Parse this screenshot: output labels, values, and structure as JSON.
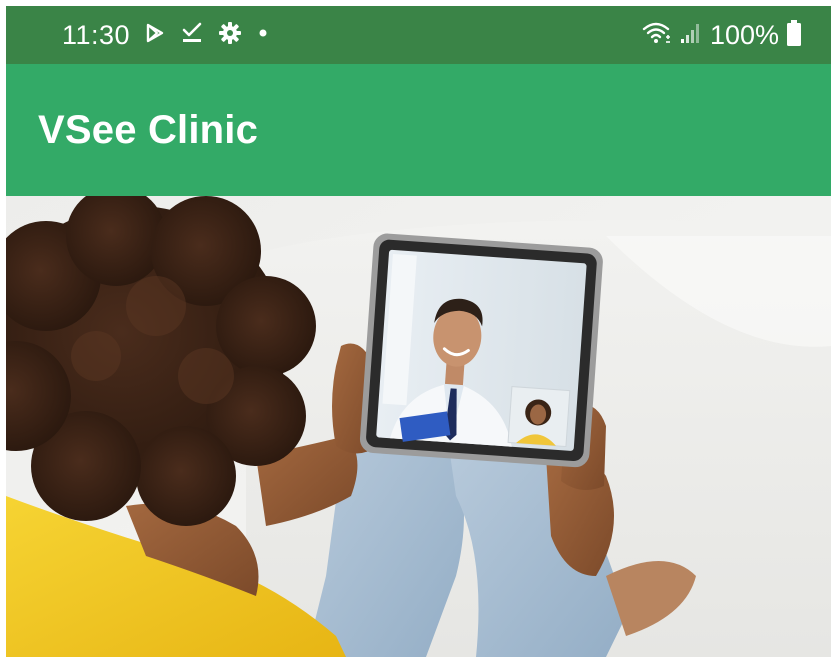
{
  "status_bar": {
    "time": "11:30",
    "battery": "100%",
    "icons": [
      "play-store-icon",
      "download-done-icon",
      "gear-icon",
      "notification-dot-icon",
      "wifi-icon",
      "signal-icon",
      "battery-icon"
    ]
  },
  "app_bar": {
    "title": "VSee Clinic"
  },
  "hero": {
    "image": "woman-on-tablet-video-call-with-doctor"
  },
  "colors": {
    "status_bar": "#3a8447",
    "app_bar": "#33aa67",
    "title_text": "#ffffff"
  }
}
